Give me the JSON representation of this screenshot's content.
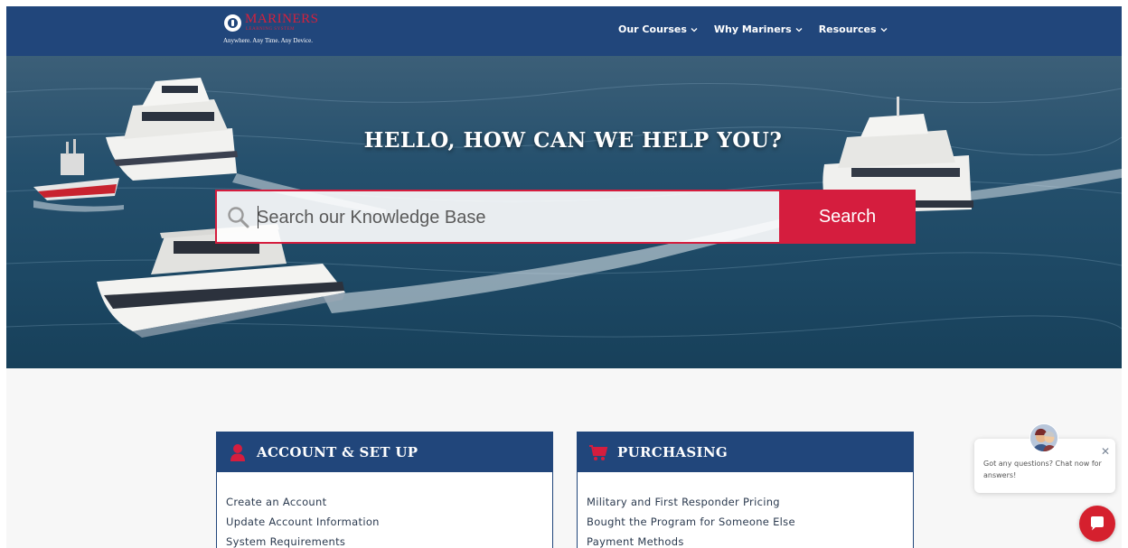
{
  "header": {
    "logo_name": "MARINERS",
    "logo_sub": "LEARNING SYSTEM",
    "logo_tagline": "Anywhere. Any Time. Any Device.",
    "nav": [
      {
        "label": "Our Courses",
        "icon": "chevron-down-icon"
      },
      {
        "label": "Why Mariners",
        "icon": "chevron-down-icon"
      },
      {
        "label": "Resources",
        "icon": "chevron-down-icon"
      }
    ]
  },
  "hero": {
    "title": "HELLO, HOW CAN WE HELP YOU?",
    "search": {
      "placeholder": "Search our Knowledge Base",
      "value": "",
      "button_label": "Search",
      "icon": "search-icon"
    }
  },
  "cards": [
    {
      "title": "ACCOUNT & SET UP",
      "icon": "user-icon",
      "links": [
        "Create an Account",
        "Update Account Information",
        "System Requirements"
      ]
    },
    {
      "title": "PURCHASING",
      "icon": "shopping-cart-icon",
      "links": [
        "Military and First Responder Pricing",
        "Bought the Program for Someone Else",
        "Payment Methods"
      ]
    }
  ],
  "chat": {
    "message": "Got any questions? Chat now for answers!",
    "close_icon": "close-icon",
    "launcher_icon": "chat-icon"
  },
  "colors": {
    "navy": "#21467b",
    "accent_red": "#d51d3e",
    "page_bg": "#f7f7f7"
  }
}
